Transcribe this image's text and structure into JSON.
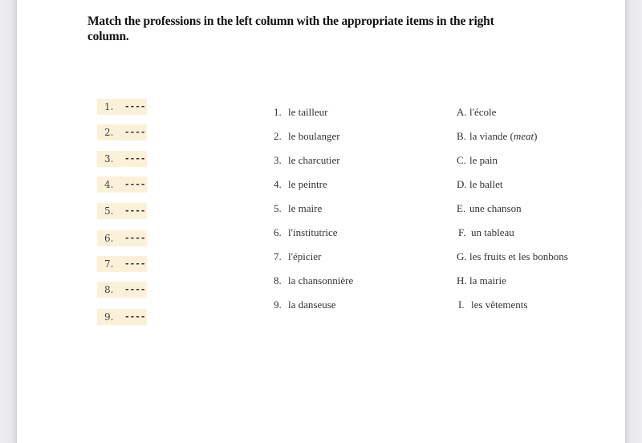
{
  "prompt": "Match the professions in the left column with the appropriate items in the right column.",
  "answers": [
    {
      "number": "1.",
      "blank": "----"
    },
    {
      "number": "2.",
      "blank": "----"
    },
    {
      "number": "3.",
      "blank": "----"
    },
    {
      "number": "4.",
      "blank": "----"
    },
    {
      "number": "5.",
      "blank": "----"
    },
    {
      "number": "6.",
      "blank": "----"
    },
    {
      "number": "7.",
      "blank": "----"
    },
    {
      "number": "8.",
      "blank": "----"
    },
    {
      "number": "9.",
      "blank": "----"
    }
  ],
  "professions": [
    {
      "index": "1.",
      "text": "le tailleur"
    },
    {
      "index": "2.",
      "text": "le boulanger"
    },
    {
      "index": "3.",
      "text": "le charcutier"
    },
    {
      "index": "4.",
      "text": "le peintre"
    },
    {
      "index": "5.",
      "text": "le maire"
    },
    {
      "index": "6.",
      "text": "l'institutrice"
    },
    {
      "index": "7.",
      "text": "l'épicier"
    },
    {
      "index": "8.",
      "text": "la chansonnière"
    },
    {
      "index": "9.",
      "text": "la danseuse"
    }
  ],
  "items": [
    {
      "index": "A.",
      "text": "l'école"
    },
    {
      "index": "B.",
      "text": "la viande",
      "note": "meat"
    },
    {
      "index": "C.",
      "text": "le pain"
    },
    {
      "index": "D.",
      "text": "le ballet"
    },
    {
      "index": "E.",
      "text": "une chanson"
    },
    {
      "index": "F.",
      "text": "un tableau"
    },
    {
      "index": "G.",
      "text": "les fruits et les bonbons"
    },
    {
      "index": "H.",
      "text": "la mairie"
    },
    {
      "index": "I.",
      "text": "les vêtements"
    }
  ],
  "colors": {
    "answer_highlight": "#fbf1d9",
    "gutter": "#e8e8ed"
  }
}
